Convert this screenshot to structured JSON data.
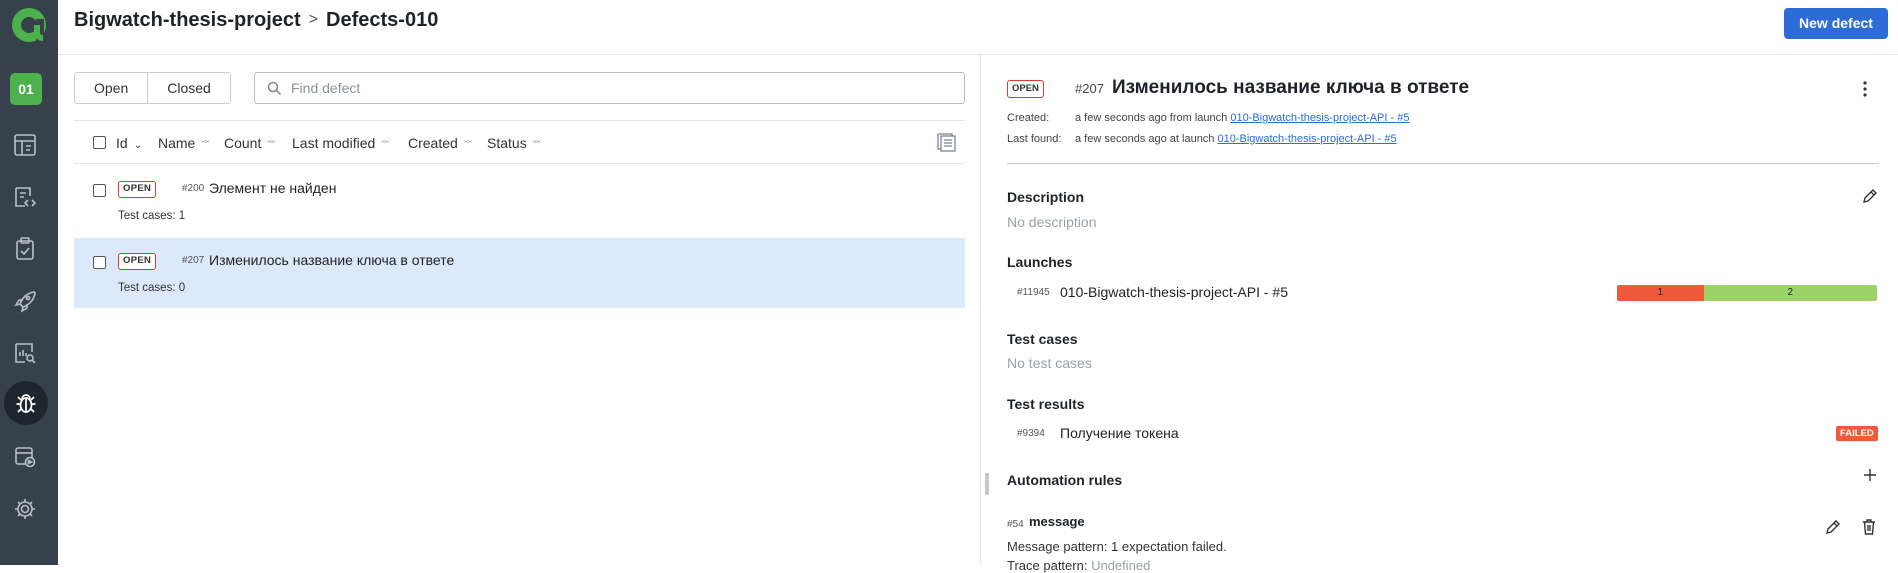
{
  "nav": {
    "project_badge": "01",
    "items": [
      "dashboards-icon",
      "testcases-icon",
      "testplans-icon",
      "launches-icon",
      "analytics-icon",
      "defects-icon",
      "jobs-icon",
      "settings-icon"
    ]
  },
  "header": {
    "breadcrumb_project": "Bigwatch-thesis-project",
    "breadcrumb_separator": ">",
    "breadcrumb_page": "Defects-010",
    "new_defect_label": "New defect"
  },
  "filters": {
    "tabs": [
      "Open",
      "Closed"
    ],
    "search_placeholder": "Find defect"
  },
  "table": {
    "columns": [
      "Id",
      "Name",
      "Count",
      "Last modified",
      "Created",
      "Status"
    ],
    "rows": [
      {
        "status": "OPEN",
        "id": "#200",
        "name": "Элемент не найден",
        "test_cases": "Test cases: 1",
        "selected": false
      },
      {
        "status": "OPEN",
        "id": "#207",
        "name": "Изменилось название ключа в ответе",
        "test_cases": "Test cases: 0",
        "selected": true
      }
    ]
  },
  "detail": {
    "status": "OPEN",
    "id": "#207",
    "title": "Изменилось название ключа в ответе",
    "created_label": "Created:",
    "created_text": "a few seconds ago from launch",
    "created_link": "010-Bigwatch-thesis-project-API - #5",
    "last_found_label": "Last found:",
    "last_found_text": "a few seconds ago at launch",
    "last_found_link": "010-Bigwatch-thesis-project-API - #5",
    "description_heading": "Description",
    "description_value": "No description",
    "launches_heading": "Launches",
    "launch": {
      "id": "#11945",
      "name": "010-Bigwatch-thesis-project-API - #5",
      "failed": "1",
      "passed": "2",
      "failed_fraction": 0.333
    },
    "test_cases_heading": "Test cases",
    "test_cases_value": "No test cases",
    "test_results_heading": "Test results",
    "test_result": {
      "id": "#9394",
      "name": "Получение токена",
      "status": "FAILED"
    },
    "automation_heading": "Automation rules",
    "rule": {
      "id": "#54",
      "name": "message",
      "message_pattern": "Message pattern: 1 expectation failed.",
      "trace_label": "Trace pattern:",
      "trace_value": "Undefined"
    }
  },
  "colors": {
    "accent": "#2d6bd7",
    "sidebar": "#36414b",
    "failed": "#f05a3c",
    "passed": "#9bd36a",
    "project": "#4cb04d",
    "selected_row": "#dce9fb"
  }
}
